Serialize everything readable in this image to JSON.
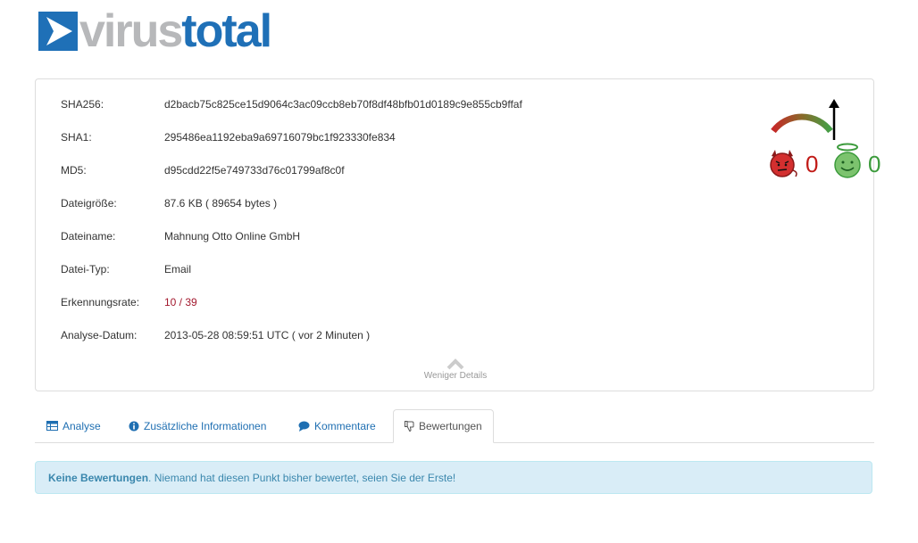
{
  "logo": {
    "virus": "virus",
    "total": "total"
  },
  "details": [
    {
      "label": "SHA256:",
      "value": "d2bacb75c825ce15d9064c3ac09ccb8eb70f8df48bfb01d0189c9e855cb9ffaf"
    },
    {
      "label": "SHA1:",
      "value": "295486ea1192eba9a69716079bc1f923330fe834"
    },
    {
      "label": "MD5:",
      "value": "d95cdd22f5e749733d76c01799af8c0f"
    },
    {
      "label": "Dateigröße:",
      "value": "87.6 KB ( 89654 bytes )"
    },
    {
      "label": "Dateiname:",
      "value": "Mahnung Otto Online GmbH"
    },
    {
      "label": "Datei-Typ:",
      "value": "Email"
    },
    {
      "label": "Erkennungsrate:",
      "value": "10 / 39"
    },
    {
      "label": "Analyse-Datum:",
      "value": "2013-05-28 08:59:51 UTC ( vor 2 Minuten )"
    }
  ],
  "less_details": "Weniger Details",
  "votes": {
    "malicious": "0",
    "harmless": "0"
  },
  "tabs": [
    {
      "label": "Analyse",
      "icon": "table-icon"
    },
    {
      "label": "Zusätzliche Informationen",
      "icon": "info-icon"
    },
    {
      "label": "Kommentare",
      "icon": "comment-icon"
    },
    {
      "label": "Bewertungen",
      "icon": "thumbs-down-icon",
      "active": true
    }
  ],
  "alert": {
    "strong": "Keine Bewertungen",
    "text": ". Niemand hat diesen Punkt bisher bewertet, seien Sie der Erste!"
  },
  "colors": {
    "brand_blue": "#1f70b7",
    "brand_gray": "#b7b8ba",
    "detection_red": "#a3192e",
    "alert_bg": "#d9edf7",
    "alert_text": "#3a87ad"
  }
}
